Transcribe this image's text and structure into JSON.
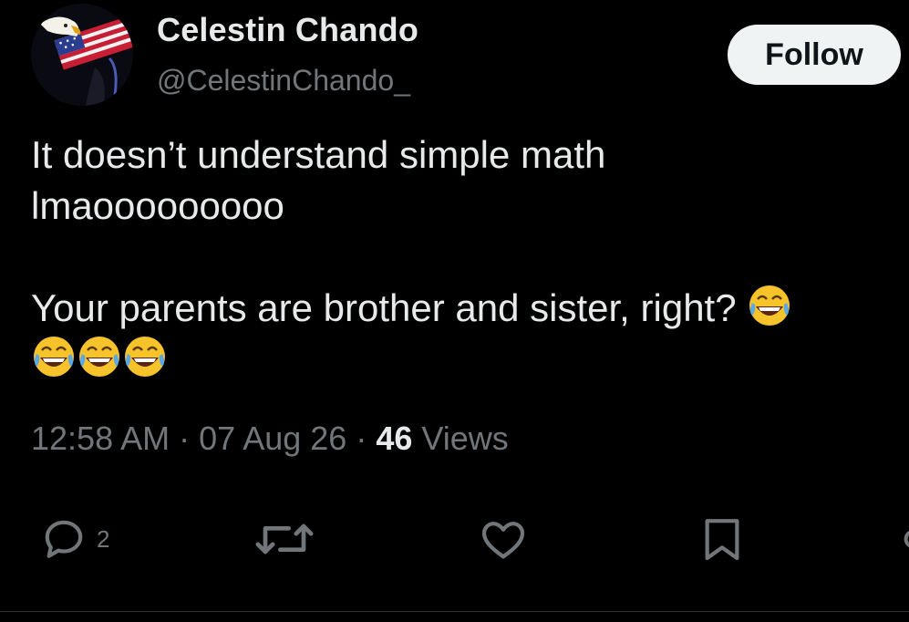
{
  "user": {
    "display_name": "Celestin Chando",
    "handle": "@CelestinChando_",
    "avatar_icon": "eagle-flag-avatar"
  },
  "follow_label": "Follow",
  "tweet": {
    "line1": "It doesn’t understand simple math",
    "line2": "lmaooooooooo",
    "line3": "Your parents are brother and sister, right?",
    "emoji": "face-with-tears-of-joy",
    "emoji_count_trailing": 4
  },
  "meta": {
    "time": "12:58 AM",
    "separator": "·",
    "date": "07 Aug 26",
    "views_count": "46",
    "views_label": "Views"
  },
  "actions": {
    "reply_count": "2",
    "reply_icon": "reply-icon",
    "retweet_icon": "retweet-icon",
    "like_icon": "heart-icon",
    "bookmark_icon": "bookmark-icon",
    "share_icon": "share-icon"
  },
  "colors": {
    "background": "#000000",
    "text": "#e7e9ea",
    "secondary": "#71767b",
    "button_bg": "#eff3f4"
  }
}
